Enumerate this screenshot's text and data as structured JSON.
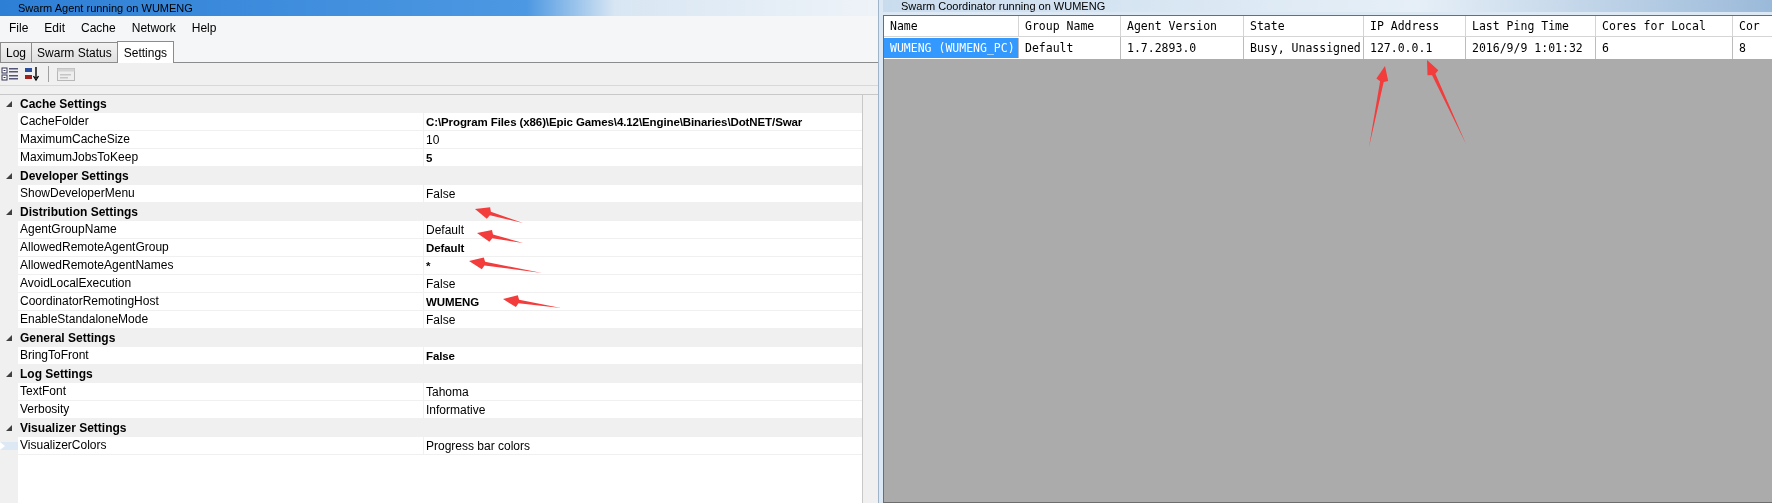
{
  "agent_window": {
    "title": "Swarm Agent running on WUMENG",
    "menu": [
      "File",
      "Edit",
      "Cache",
      "Network",
      "Help"
    ],
    "tabs": [
      {
        "label": "Log",
        "selected": false
      },
      {
        "label": "Swarm Status",
        "selected": false
      },
      {
        "label": "Settings",
        "selected": true
      }
    ],
    "property_grid": {
      "categories": [
        {
          "name": "Cache Settings",
          "expanded": true,
          "properties": [
            {
              "name": "CacheFolder",
              "value": "C:\\Program Files (x86)\\Epic Games\\4.12\\Engine\\Binaries\\DotNET/Swar",
              "bold": true,
              "kind": "plain"
            },
            {
              "name": "MaximumCacheSize",
              "value": "10",
              "bold": false,
              "kind": "plain"
            },
            {
              "name": "MaximumJobsToKeep",
              "value": "5",
              "bold": true,
              "kind": "plain"
            }
          ]
        },
        {
          "name": "Developer Settings",
          "expanded": true,
          "properties": [
            {
              "name": "ShowDeveloperMenu",
              "value": "False",
              "bold": false,
              "kind": "plain"
            }
          ]
        },
        {
          "name": "Distribution Settings",
          "expanded": true,
          "properties": [
            {
              "name": "AgentGroupName",
              "value": "Default",
              "bold": false,
              "kind": "plain"
            },
            {
              "name": "AllowedRemoteAgentGroup",
              "value": "Default",
              "bold": true,
              "kind": "plain"
            },
            {
              "name": "AllowedRemoteAgentNames",
              "value": "*",
              "bold": true,
              "kind": "plain"
            },
            {
              "name": "AvoidLocalExecution",
              "value": "False",
              "bold": false,
              "kind": "plain"
            },
            {
              "name": "CoordinatorRemotingHost",
              "value": "WUMENG",
              "bold": true,
              "kind": "plain"
            },
            {
              "name": "EnableStandaloneMode",
              "value": "False",
              "bold": false,
              "kind": "plain"
            }
          ]
        },
        {
          "name": "General Settings",
          "expanded": true,
          "properties": [
            {
              "name": "BringToFront",
              "value": "False",
              "bold": true,
              "kind": "plain"
            }
          ]
        },
        {
          "name": "Log Settings",
          "expanded": true,
          "properties": [
            {
              "name": "TextFont",
              "value": "Tahoma",
              "bold": false,
              "kind": "plain"
            },
            {
              "name": "Verbosity",
              "value": "Informative",
              "bold": false,
              "kind": "plain"
            }
          ]
        },
        {
          "name": "Visualizer Settings",
          "expanded": true,
          "properties": [
            {
              "name": "VisualizerColors",
              "value": "Progress bar colors",
              "bold": false,
              "kind": "collapsible"
            }
          ]
        }
      ]
    }
  },
  "coordinator_window": {
    "title": "Swarm Coordinator running on WUMENG",
    "table": {
      "columns": [
        "Name",
        "Group Name",
        "Agent Version",
        "State",
        "IP Address",
        "Last Ping Time",
        "Cores for Local",
        "Cor"
      ],
      "rows": [
        {
          "selected": true,
          "cells": [
            "WUMENG (WUMENG_PC)",
            "Default",
            "1.7.2893.0",
            "Busy, Unassigned",
            "127.0.0.1",
            "2016/9/9 1:01:32",
            "6",
            "8"
          ]
        }
      ]
    }
  }
}
